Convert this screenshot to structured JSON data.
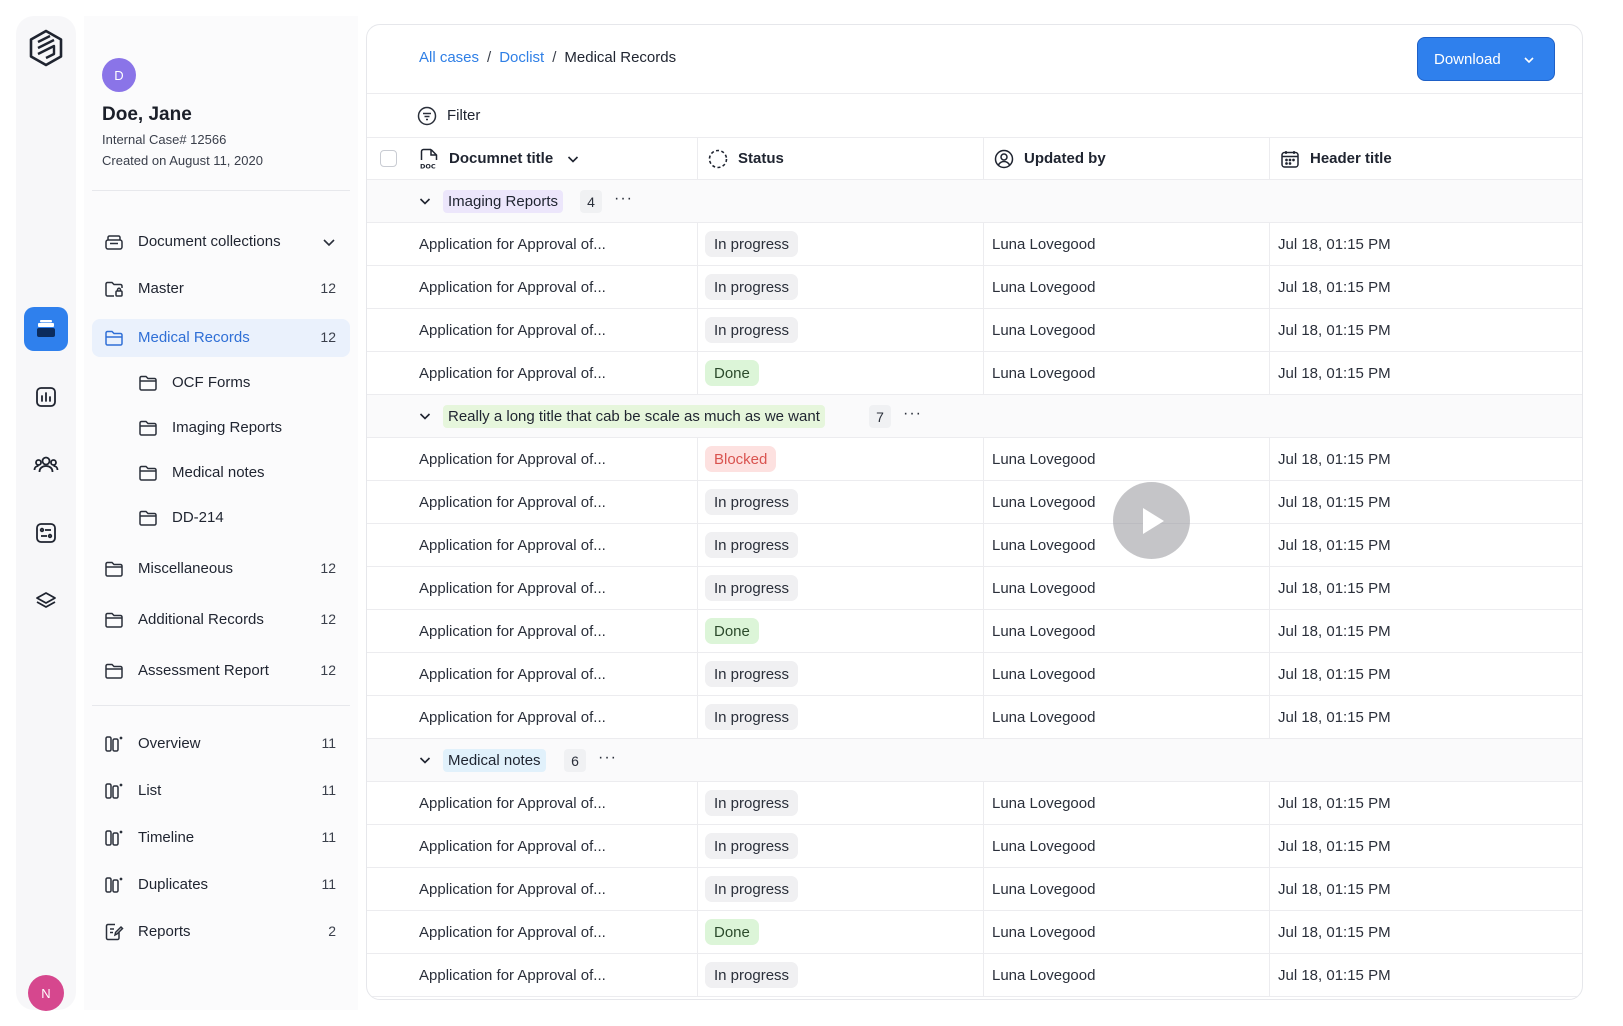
{
  "app": {
    "brand_icon": "hexagon-logo-icon"
  },
  "rail": {
    "items": [
      {
        "name": "documents",
        "icon": "stack-icon",
        "active": true
      },
      {
        "name": "analytics",
        "icon": "chart-icon",
        "active": false
      },
      {
        "name": "people",
        "icon": "users-icon",
        "active": false
      },
      {
        "name": "tasks",
        "icon": "list-card-icon",
        "active": false
      },
      {
        "name": "layers",
        "icon": "layers-icon",
        "active": false
      }
    ],
    "user_initial": "N"
  },
  "patient": {
    "initial": "D",
    "name": "Doe, Jane",
    "case": "Internal Case# 12566",
    "created": "Created on  August 11, 2020"
  },
  "sidebar": {
    "collections_label": "Document collections",
    "items": [
      {
        "label": "Master",
        "count": "12"
      },
      {
        "label": "Medical Records",
        "count": "12"
      },
      {
        "label": "OCF Forms"
      },
      {
        "label": "Imaging Reports"
      },
      {
        "label": "Medical notes"
      },
      {
        "label": "DD-214"
      },
      {
        "label": "Miscellaneous",
        "count": "12"
      },
      {
        "label": "Additional Records",
        "count": "12"
      },
      {
        "label": "Assessment Report",
        "count": "12"
      }
    ],
    "views": [
      {
        "label": "Overview",
        "count": "11"
      },
      {
        "label": "List",
        "count": "11"
      },
      {
        "label": "Timeline",
        "count": "11"
      },
      {
        "label": "Duplicates",
        "count": "11"
      },
      {
        "label": "Reports",
        "count": "2"
      }
    ]
  },
  "breadcrumb": {
    "root": "All cases",
    "parent": "Doclist",
    "current": "Medical Records"
  },
  "toolbar": {
    "download_label": "Download",
    "filter_label": "Filter"
  },
  "table": {
    "headers": {
      "title": "Documnet title",
      "status": "Status",
      "updated_by": "Updated by",
      "header": "Header title"
    },
    "groups": [
      {
        "name": "Imaging Reports",
        "count": "4",
        "color": "#ece6fb",
        "more": "···",
        "rows": [
          {
            "title": "Application for Approval of...",
            "status": "In progress",
            "by": "Luna Lovegood",
            "date": "Jul 18, 01:15 PM"
          },
          {
            "title": "Application for Approval of...",
            "status": "In progress",
            "by": "Luna Lovegood",
            "date": "Jul 18, 01:15 PM"
          },
          {
            "title": "Application for Approval of...",
            "status": "In progress",
            "by": "Luna Lovegood",
            "date": "Jul 18, 01:15 PM"
          },
          {
            "title": "Application for Approval of...",
            "status": "Done",
            "by": "Luna Lovegood",
            "date": "Jul 18, 01:15 PM"
          }
        ]
      },
      {
        "name": "Really a long title that cab be scale as much as we want",
        "count": "7",
        "color": "#e6f6dc",
        "more": "···",
        "rows": [
          {
            "title": "Application for Approval of...",
            "status": "Blocked",
            "by": "Luna Lovegood",
            "date": "Jul 18, 01:15 PM"
          },
          {
            "title": "Application for Approval of...",
            "status": "In progress",
            "by": "Luna Lovegood",
            "date": "Jul 18, 01:15 PM"
          },
          {
            "title": "Application for Approval of...",
            "status": "In progress",
            "by": "Luna Lovegood",
            "date": "Jul 18, 01:15 PM"
          },
          {
            "title": "Application for Approval of...",
            "status": "In progress",
            "by": "Luna Lovegood",
            "date": "Jul 18, 01:15 PM"
          },
          {
            "title": "Application for Approval of...",
            "status": "Done",
            "by": "Luna Lovegood",
            "date": "Jul 18, 01:15 PM"
          },
          {
            "title": "Application for Approval of...",
            "status": "In progress",
            "by": "Luna Lovegood",
            "date": "Jul 18, 01:15 PM"
          },
          {
            "title": "Application for Approval of...",
            "status": "In progress",
            "by": "Luna Lovegood",
            "date": "Jul 18, 01:15 PM"
          }
        ]
      },
      {
        "name": "Medical notes",
        "count": "6",
        "color": "#e1f1fb",
        "more": "···",
        "rows": [
          {
            "title": "Application for Approval of...",
            "status": "In progress",
            "by": "Luna Lovegood",
            "date": "Jul 18, 01:15 PM"
          },
          {
            "title": "Application for Approval of...",
            "status": "In progress",
            "by": "Luna Lovegood",
            "date": "Jul 18, 01:15 PM"
          },
          {
            "title": "Application for Approval of...",
            "status": "In progress",
            "by": "Luna Lovegood",
            "date": "Jul 18, 01:15 PM"
          },
          {
            "title": "Application for Approval of...",
            "status": "Done",
            "by": "Luna Lovegood",
            "date": "Jul 18, 01:15 PM"
          },
          {
            "title": "Application for Approval of...",
            "status": "In progress",
            "by": "Luna Lovegood",
            "date": "Jul 18, 01:15 PM"
          }
        ]
      }
    ]
  },
  "colors": {
    "accent": "#2f80ed",
    "done": "#dcf5d8",
    "blocked": "#fde1e0",
    "progress": "#f0f0f2"
  },
  "overlay": {
    "icon": "play-icon"
  }
}
